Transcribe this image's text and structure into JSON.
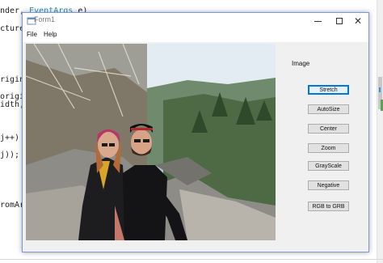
{
  "editor": {
    "lines": [
      {
        "pre": "nder, ",
        "type": "EventArgs",
        "post": " e)"
      },
      {
        "pre": "cture",
        "type": "",
        "post": ""
      },
      {
        "pre": "rigina",
        "type": "",
        "post": ""
      },
      {
        "pre": "origin",
        "type": "",
        "post": ""
      },
      {
        "pre": "idth,",
        "type": "",
        "post": ""
      },
      {
        "pre": " j++)",
        "type": "",
        "post": ""
      },
      {
        "pre": "j));",
        "type": "",
        "post": ""
      },
      {
        "pre": "romAr",
        "type": "",
        "post": ""
      }
    ]
  },
  "window": {
    "title": "Form1",
    "controls": {
      "minimize": "minimize",
      "maximize": "maximize",
      "close": "✕"
    }
  },
  "menu": {
    "file": "File",
    "help": "Help"
  },
  "picture": {
    "description_icon": "photo"
  },
  "panel": {
    "label": "Image",
    "buttons": [
      {
        "label": "Stretch",
        "active": true
      },
      {
        "label": "AutoSize",
        "active": false
      },
      {
        "label": "Center",
        "active": false
      },
      {
        "label": "Zoom",
        "active": false
      },
      {
        "label": "GrayScale",
        "active": false
      },
      {
        "label": "Negative",
        "active": false
      },
      {
        "label": "RGB to GRB",
        "active": false
      }
    ]
  },
  "colors": {
    "accent": "#0078d7",
    "window_border": "#7a9bd1",
    "form_bg": "#f0f0f0"
  }
}
